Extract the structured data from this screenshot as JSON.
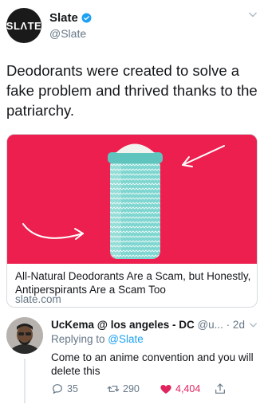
{
  "tweet": {
    "avatar_text": "SLΛTE",
    "display_name": "Slate",
    "handle": "@Slate",
    "text": "Deodorants were created to solve a fake problem and thrived thanks to the patriarchy."
  },
  "card": {
    "title": "All-Natural Deodorants Are a Scam, but Honestly, Antiperspirants Are a Scam Too",
    "domain": "slate.com"
  },
  "reply": {
    "display_name": "UcKema @ los angeles - DC",
    "handle_time": " @u... · 2d",
    "replying_prefix": "Replying to ",
    "replying_to": "@Slate",
    "text": "Come to an anime convention and you will delete this",
    "reply_count": "35",
    "retweet_count": "290",
    "like_count": "4,404"
  },
  "colors": {
    "card_background": "#ec1f4e",
    "stick_teal": "#7fd6d0",
    "link_blue": "#1da1f2",
    "like_red": "#e0245e",
    "muted_gray": "#657786"
  },
  "icons": [
    "verified-badge-icon",
    "chevron-down-icon",
    "reply-icon",
    "retweet-icon",
    "heart-icon",
    "share-icon"
  ]
}
